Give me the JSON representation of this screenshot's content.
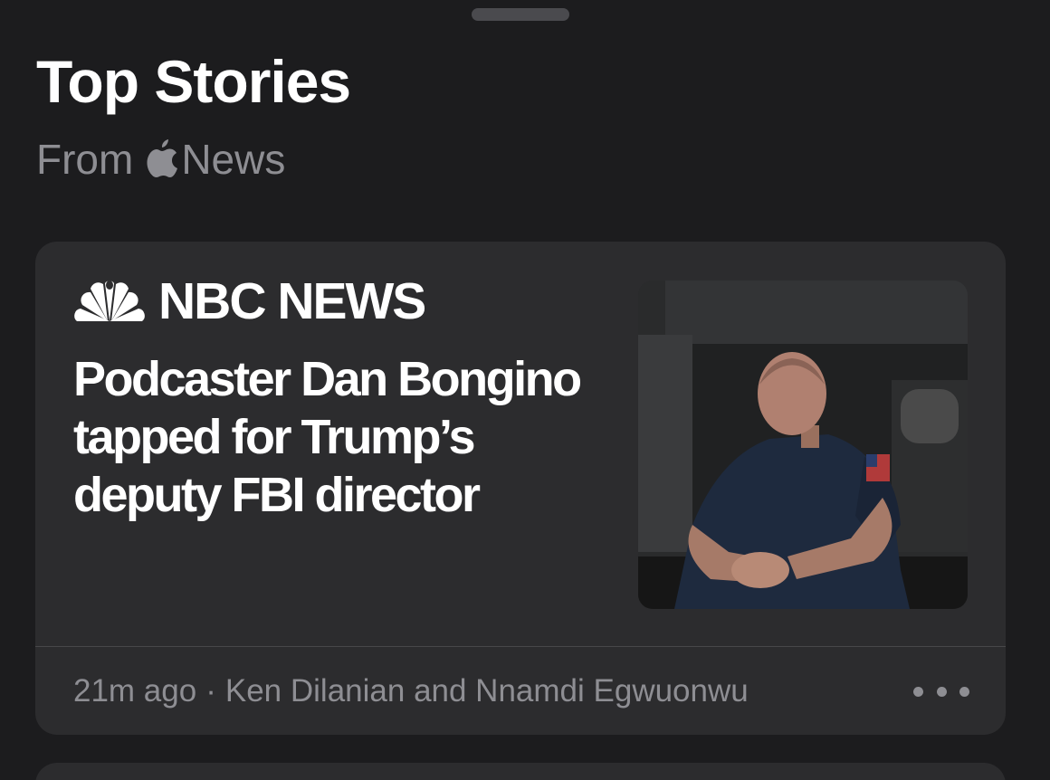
{
  "sheet": {
    "title": "Top Stories",
    "subtitle_prefix": "From",
    "subtitle_source": "News"
  },
  "story": {
    "publisher": "NBC NEWS",
    "headline": "Podcaster Dan Bongino tapped for Trump’s deputy FBI director",
    "time": "21m ago",
    "separator": "·",
    "authors": "Ken Dilanian and Nnamdi Egwuonwu"
  },
  "icons": {
    "brand": "apple-logo-icon",
    "publisher_logo": "nbc-peacock-icon",
    "more": "ellipsis-icon"
  },
  "colors": {
    "background": "#1c1c1e",
    "card": "#2c2c2e",
    "secondary_text": "#8e8e93",
    "primary_text": "#ffffff"
  }
}
